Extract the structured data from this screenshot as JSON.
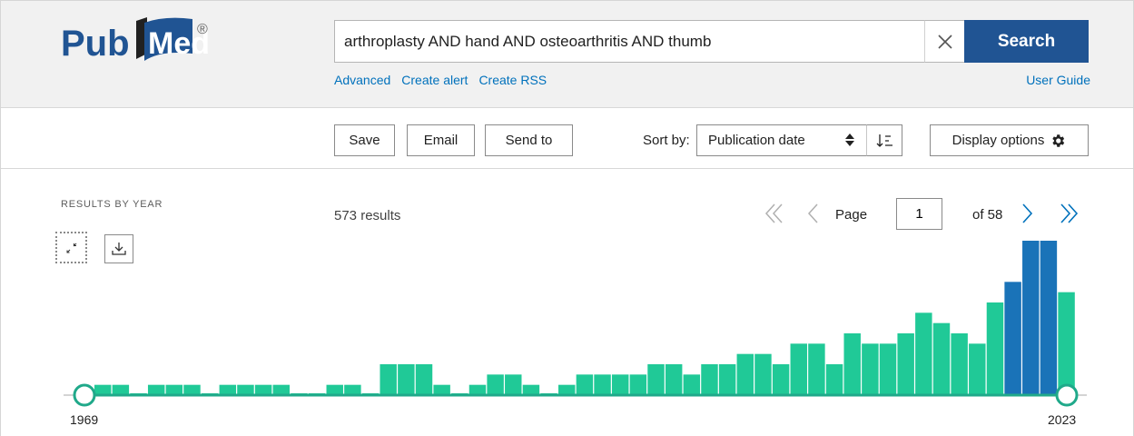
{
  "header": {
    "logo_text": "PubMed",
    "logo_mark": "®",
    "search_value": "arthroplasty AND hand AND osteoarthritis AND thumb",
    "search_button": "Search",
    "links": [
      "Advanced",
      "Create alert",
      "Create RSS"
    ],
    "user_guide": "User Guide"
  },
  "actions": {
    "save": "Save",
    "email": "Email",
    "send_to": "Send to",
    "sort_label": "Sort by:",
    "sort_value": "Publication date",
    "display_options": "Display options"
  },
  "results": {
    "by_year_title": "RESULTS BY YEAR",
    "count_text": "573 results",
    "page_label": "Page",
    "page_value": "1",
    "of_label": "of 58"
  },
  "colors": {
    "brand_blue": "#205493",
    "link_blue": "#0071bc",
    "bar_green": "#20c997",
    "bar_blue": "#1a73b8"
  },
  "icons": {
    "clear": "close-icon",
    "sort_arrows": "up-down-arrows-icon",
    "sort_order": "sort-descending-icon",
    "display": "gear-icon",
    "collapse": "collapse-icon",
    "download": "download-icon",
    "first": "double-chevron-left-icon",
    "prev": "chevron-left-icon",
    "next": "chevron-right-icon",
    "last": "double-chevron-right-icon"
  },
  "chart_data": {
    "type": "bar",
    "title": "RESULTS BY YEAR",
    "x_start_label": "1969",
    "x_end_label": "2023",
    "categories": [
      "1969",
      "1970",
      "1971",
      "1972",
      "1973",
      "1974",
      "1975",
      "1976",
      "1977",
      "1978",
      "1979",
      "1980",
      "1981",
      "1982",
      "1983",
      "1984",
      "1985",
      "1986",
      "1987",
      "1988",
      "1989",
      "1990",
      "1991",
      "1992",
      "1993",
      "1994",
      "1995",
      "1996",
      "1997",
      "1998",
      "1999",
      "2000",
      "2001",
      "2002",
      "2003",
      "2004",
      "2005",
      "2006",
      "2007",
      "2008",
      "2009",
      "2010",
      "2011",
      "2012",
      "2013",
      "2014",
      "2015",
      "2016",
      "2017",
      "2018",
      "2019",
      "2020",
      "2021",
      "2022",
      "2023"
    ],
    "values": [
      1,
      1,
      0,
      1,
      1,
      1,
      0,
      1,
      1,
      1,
      1,
      0,
      0,
      1,
      1,
      0,
      3,
      3,
      3,
      1,
      0,
      1,
      2,
      2,
      1,
      0,
      1,
      2,
      2,
      2,
      2,
      3,
      3,
      2,
      3,
      3,
      4,
      4,
      3,
      5,
      5,
      3,
      6,
      5,
      5,
      6,
      8,
      7,
      6,
      5,
      9,
      11,
      15,
      15,
      10
    ],
    "highlight_last_n": 3,
    "ylim": [
      0,
      15
    ]
  }
}
